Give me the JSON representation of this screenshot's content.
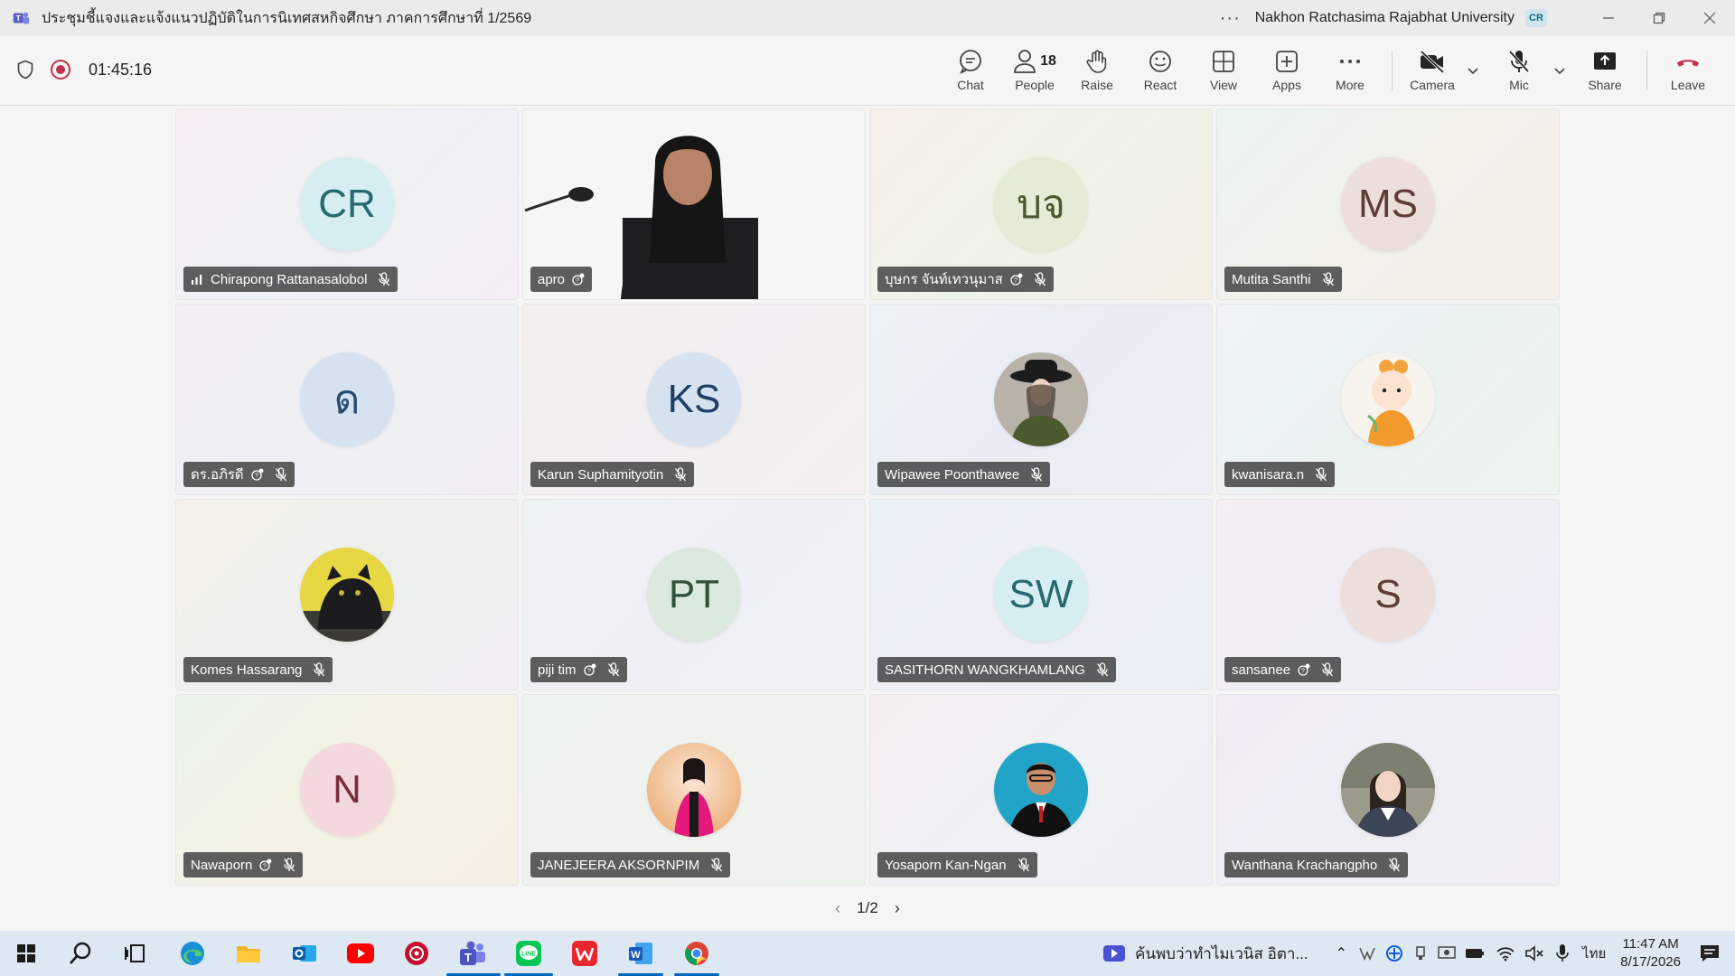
{
  "window": {
    "title": "ประชุมชี้แจงและแจ้งแนวปฏิบัติในการนิเทศสหกิจศึกษา ภาคการศึกษาที่ 1/2569",
    "org": "Nakhon Ratchasima Rajabhat University",
    "me_initials": "CR"
  },
  "toolbar": {
    "timer": "01:45:16",
    "chat": "Chat",
    "people": "People",
    "people_count": "18",
    "raise": "Raise",
    "react": "React",
    "view": "View",
    "apps": "Apps",
    "more": "More",
    "camera": "Camera",
    "mic": "Mic",
    "share": "Share",
    "leave": "Leave"
  },
  "participants": [
    {
      "name": "Chirapong Rattanasalobol",
      "initials": "CR",
      "speaking": true,
      "avatar_bg": "#d6eef2",
      "avatar_fg": "#276a6e",
      "tile_bg": "linear-gradient(135deg,#f7eef2,#eef1f6,#f4eef6)"
    },
    {
      "name": "apro",
      "initials": "",
      "video": true,
      "tile_bg": "#f7f7f7"
    },
    {
      "name": "บุษกร จันท์เทวนุมาส",
      "initials": "บจ",
      "avatar_bg": "#e4ecd8",
      "avatar_fg": "#4a5a2e",
      "tile_bg": "linear-gradient(135deg,#f7efe8,#eef3e8,#f4efe6)"
    },
    {
      "name": "Mutita Santhi",
      "initials": "MS",
      "avatar_bg": "#ecdedb",
      "avatar_fg": "#5e3c36",
      "tile_bg": "linear-gradient(135deg,#eaf4f1,#f2f1ea,#f4efe8)"
    },
    {
      "name": "ดร.อภิรดี",
      "initials": "ด",
      "avatar_bg": "#d6e2ef",
      "avatar_fg": "#274b73",
      "tile_bg": "linear-gradient(135deg,#f3eef3,#eef0f5,#f1eef3)"
    },
    {
      "name": "Karun Suphamityotin",
      "initials": "KS",
      "avatar_bg": "#d6e2ef",
      "avatar_fg": "#1e3f66",
      "tile_bg": "linear-gradient(135deg,#f4eeee,#f1eff2,#f5efee)"
    },
    {
      "name": "Wipawee Poonthawee",
      "initials": "",
      "photo": "woman-hat",
      "tile_bg": "linear-gradient(135deg,#eef2f6,#e9ecf4,#eeeff6)"
    },
    {
      "name": "kwanisara.n",
      "initials": "",
      "photo": "baby",
      "tile_bg": "linear-gradient(135deg,#f0f4f8,#eaf2f0,#eef4ee)"
    },
    {
      "name": "Komes Hassarang",
      "initials": "",
      "photo": "cat",
      "tile_bg": "linear-gradient(135deg,#f4f2e8,#eef0ee,#f0eef2)"
    },
    {
      "name": "piji tim",
      "initials": "PT",
      "avatar_bg": "#dbe8de",
      "avatar_fg": "#2f5238",
      "tile_bg": "linear-gradient(135deg,#eef3f4,#eff0f5,#eef2f6)"
    },
    {
      "name": "SASITHORN WANGKHAMLANG",
      "initials": "SW",
      "avatar_bg": "#d6eef2",
      "avatar_fg": "#276a6e",
      "tile_bg": "linear-gradient(135deg,#eaf1f6,#eeeff7,#e9f0f5)"
    },
    {
      "name": "sansanee",
      "initials": "S",
      "avatar_bg": "#ecdedb",
      "avatar_fg": "#5e3c36",
      "tile_bg": "linear-gradient(135deg,#f5eef3,#efeef5,#f1edf6)"
    },
    {
      "name": "Nawaporn",
      "initials": "N",
      "avatar_bg": "#f3d9dd",
      "avatar_fg": "#7a2d3a",
      "tile_bg": "linear-gradient(135deg,#eaf4ea,#f4f2e4,#f6f0e2)"
    },
    {
      "name": "JANEJEERA AKSORNPIM",
      "initials": "",
      "photo": "woman-pink",
      "tile_bg": "linear-gradient(135deg,#edf4f2,#f0f2ee,#eef3ee)"
    },
    {
      "name": "Yosaporn Kan-Ngan",
      "initials": "",
      "photo": "man-suit",
      "tile_bg": "linear-gradient(135deg,#f5eef0,#eff1f5,#eef0f5)"
    },
    {
      "name": "Wanthana Krachangpho",
      "initials": "",
      "photo": "woman-blazer",
      "tile_bg": "linear-gradient(135deg,#f1ecf5,#eeeef5,#f0eef2)"
    }
  ],
  "pager": {
    "text": "1/2"
  },
  "taskbar": {
    "notification": "ค้นพบว่าทำไมเวนิส อิตา...",
    "lang": "ไทย",
    "time": "11:47 AM",
    "date": "8/17/2026"
  }
}
